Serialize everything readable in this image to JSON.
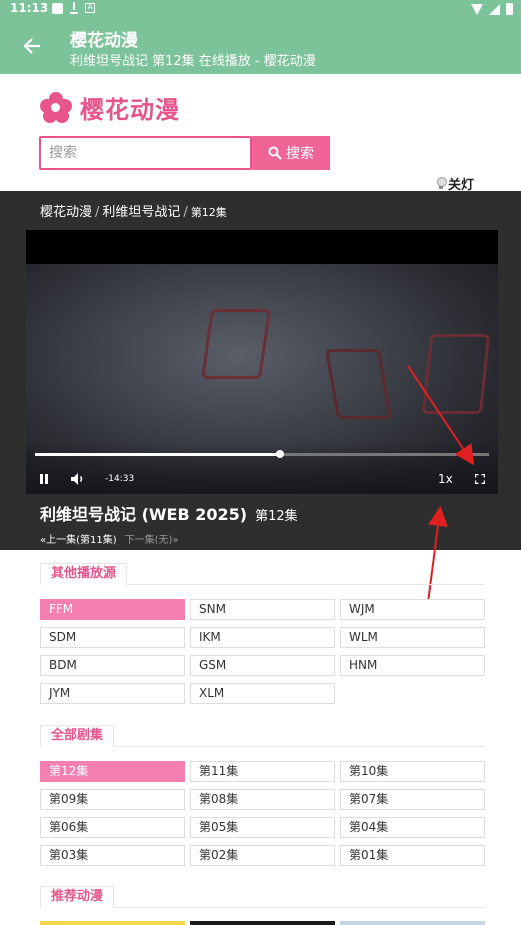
{
  "status_bar": {
    "time": "11:13"
  },
  "app_bar": {
    "title": "樱花动漫",
    "subtitle": "利维坦号战记 第12集 在线播放 - 樱花动漫"
  },
  "site": {
    "logo_text": "樱花动漫"
  },
  "search": {
    "placeholder": "搜索",
    "button_label": "搜索"
  },
  "light_toggle": {
    "label": "关灯"
  },
  "breadcrumb": {
    "home": "樱花动漫",
    "series": "利维坦号战记",
    "current": "第12集"
  },
  "player": {
    "time_display": "-14:33",
    "speed": "1x",
    "progress": 0.54
  },
  "anime": {
    "title": "利维坦号战记  (WEB 2025)",
    "episode": "第12集",
    "prev": "«上一集(第11集)",
    "next": "下一集(无)»"
  },
  "sources": {
    "heading": "其他播放源",
    "items": [
      {
        "label": "FFM",
        "active": true
      },
      {
        "label": "SNM",
        "active": false
      },
      {
        "label": "WJM",
        "active": false
      },
      {
        "label": "SDM",
        "active": false
      },
      {
        "label": "IKM",
        "active": false
      },
      {
        "label": "WLM",
        "active": false
      },
      {
        "label": "BDM",
        "active": false
      },
      {
        "label": "GSM",
        "active": false
      },
      {
        "label": "HNM",
        "active": false
      },
      {
        "label": "JYM",
        "active": false
      },
      {
        "label": "XLM",
        "active": false
      }
    ]
  },
  "episodes": {
    "heading": "全部剧集",
    "items": [
      {
        "label": "第12集",
        "active": true
      },
      {
        "label": "第11集",
        "active": false
      },
      {
        "label": "第10集",
        "active": false
      },
      {
        "label": "第09集",
        "active": false
      },
      {
        "label": "第08集",
        "active": false
      },
      {
        "label": "第07集",
        "active": false
      },
      {
        "label": "第06集",
        "active": false
      },
      {
        "label": "第05集",
        "active": false
      },
      {
        "label": "第04集",
        "active": false
      },
      {
        "label": "第03集",
        "active": false
      },
      {
        "label": "第02集",
        "active": false
      },
      {
        "label": "第01集",
        "active": false
      }
    ]
  },
  "recommend": {
    "heading": "推荐动漫"
  },
  "colors": {
    "app_bar": "#7cc39a",
    "accent_pink": "#e8558a",
    "active_cell": "#f47fb0",
    "player_bg": "#2e2e2e",
    "annotation": "#e02020"
  },
  "icons": {
    "back": "arrow-left-icon",
    "search": "search-icon",
    "bulb": "lightbulb-icon",
    "pause": "pause-icon",
    "volume": "volume-icon",
    "fullscreen": "fullscreen-icon"
  }
}
